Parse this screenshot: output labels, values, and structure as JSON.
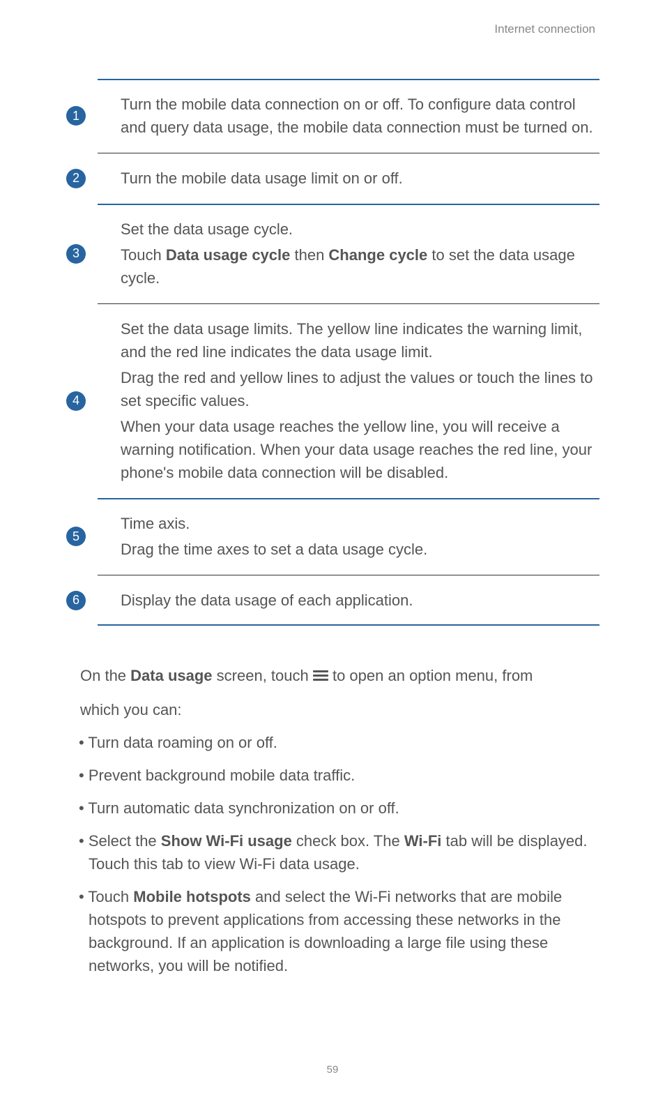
{
  "header": "Internet connection",
  "pageNumber": "59",
  "rows": [
    {
      "badge": "1",
      "paragraphs": [
        {
          "segments": [
            {
              "text": "Turn the mobile data connection on or off. To configure data control and query data usage, the mobile data connection must be turned on."
            }
          ]
        }
      ]
    },
    {
      "badge": "2",
      "paragraphs": [
        {
          "segments": [
            {
              "text": "Turn the mobile data usage limit on or off."
            }
          ]
        }
      ]
    },
    {
      "badge": "3",
      "paragraphs": [
        {
          "segments": [
            {
              "text": "Set the data usage cycle."
            }
          ]
        },
        {
          "segments": [
            {
              "text": "Touch "
            },
            {
              "text": "Data usage cycle",
              "bold": true
            },
            {
              "text": " then "
            },
            {
              "text": "Change cycle",
              "bold": true
            },
            {
              "text": " to set the data usage cycle."
            }
          ]
        }
      ]
    },
    {
      "badge": "4",
      "paragraphs": [
        {
          "segments": [
            {
              "text": "Set the data usage limits. The yellow line indicates the warning limit, and the red line indicates the data usage limit."
            }
          ]
        },
        {
          "segments": [
            {
              "text": "Drag the red and yellow lines to adjust the values or touch the lines to set specific values."
            }
          ]
        },
        {
          "segments": [
            {
              "text": "When your data usage reaches the yellow line, you will receive a warning notification. When your data usage reaches the red line, your phone's mobile data connection will be disabled."
            }
          ]
        }
      ]
    },
    {
      "badge": "5",
      "paragraphs": [
        {
          "segments": [
            {
              "text": "Time axis."
            }
          ]
        },
        {
          "segments": [
            {
              "text": "Drag the time axes to set a data usage cycle."
            }
          ]
        }
      ]
    },
    {
      "badge": "6",
      "paragraphs": [
        {
          "segments": [
            {
              "text": "Display the data usage of each application."
            }
          ]
        }
      ]
    }
  ],
  "intro": {
    "before": "On the ",
    "bold1": "Data usage",
    "mid": " screen, touch ",
    "after": " to open an option menu, from",
    "line2": "which you can:"
  },
  "bullets": [
    {
      "segments": [
        {
          "text": "Turn data roaming on or off."
        }
      ]
    },
    {
      "segments": [
        {
          "text": "Prevent background mobile data traffic."
        }
      ]
    },
    {
      "segments": [
        {
          "text": "Turn automatic data synchronization on or off."
        }
      ]
    },
    {
      "segments": [
        {
          "text": "Select the "
        },
        {
          "text": "Show Wi-Fi usage",
          "bold": true
        },
        {
          "text": " check box. The "
        },
        {
          "text": "Wi-Fi",
          "bold": true
        },
        {
          "text": " tab will be displayed. Touch this tab to view Wi-Fi data usage."
        }
      ]
    },
    {
      "segments": [
        {
          "text": "Touch "
        },
        {
          "text": "Mobile hotspots",
          "bold": true
        },
        {
          "text": " and select the Wi-Fi networks that are mobile hotspots to prevent applications from accessing these networks in the background. If an application is downloading a large file using these networks, you will be notified."
        }
      ]
    }
  ]
}
